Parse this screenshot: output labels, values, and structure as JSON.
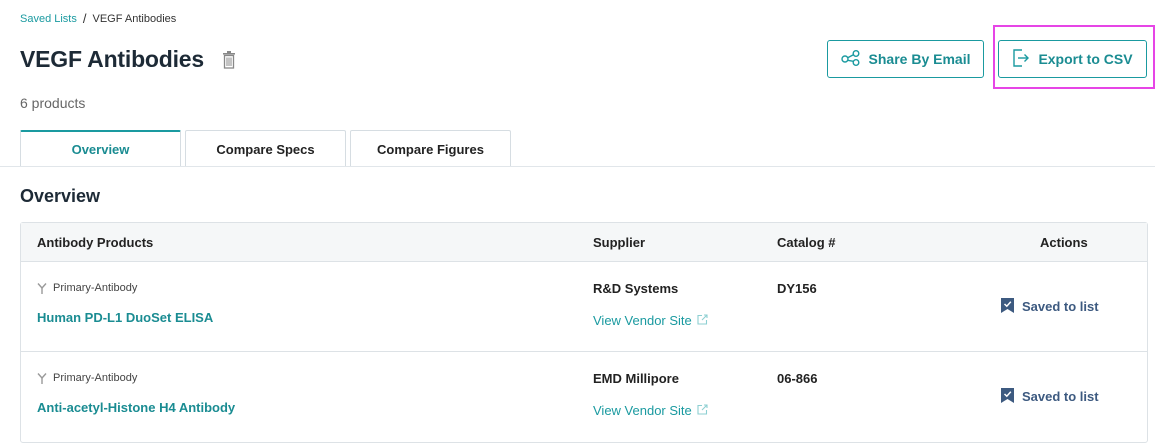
{
  "breadcrumb": {
    "parent": "Saved Lists",
    "separator": "/",
    "current": "VEGF Antibodies"
  },
  "page": {
    "title": "VEGF Antibodies",
    "count": "6 products"
  },
  "actions": {
    "share_label": "Share By Email",
    "export_label": "Export to CSV"
  },
  "tabs": [
    {
      "label": "Overview",
      "active": true
    },
    {
      "label": "Compare Specs",
      "active": false
    },
    {
      "label": "Compare Figures",
      "active": false
    }
  ],
  "section": {
    "title": "Overview"
  },
  "table": {
    "headers": {
      "products": "Antibody Products",
      "supplier": "Supplier",
      "catalog": "Catalog #",
      "actions": "Actions"
    },
    "rows": [
      {
        "type": "Primary-Antibody",
        "name": "Human PD-L1 DuoSet ELISA",
        "supplier": "R&D Systems",
        "vendor_link": "View Vendor Site",
        "catalog": "DY156",
        "action": "Saved to list"
      },
      {
        "type": "Primary-Antibody",
        "name": "Anti-acetyl-Histone H4 Antibody",
        "supplier": "EMD Millipore",
        "vendor_link": "View Vendor Site",
        "catalog": "06-866",
        "action": "Saved to list"
      }
    ]
  },
  "colors": {
    "accent": "#1a9aa0",
    "highlight": "#e645e6",
    "action": "#3d5a80"
  }
}
